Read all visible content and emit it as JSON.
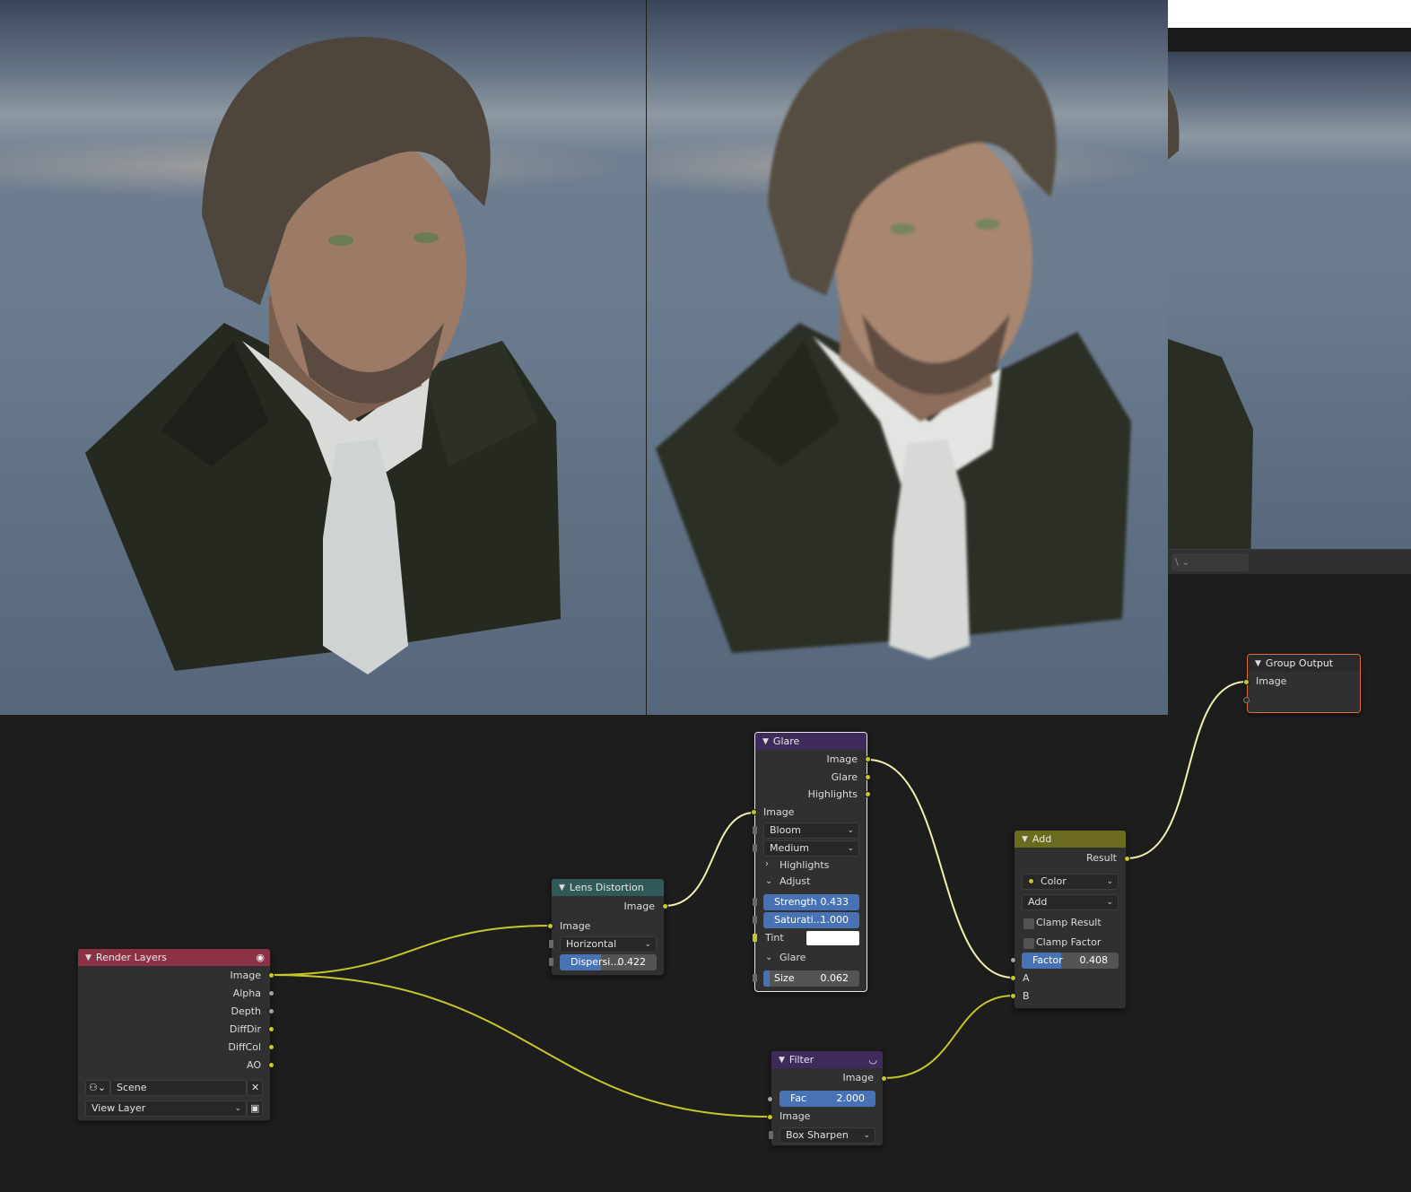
{
  "colors": {
    "render_layers_header": "#8c3246",
    "lens_distortion_header": "#305a5a",
    "glare_header": "#3f2a5c",
    "filter_header": "#3f2a5c",
    "add_header": "#6b6b1f",
    "group_output_header": "#2a2a2a",
    "socket_color": "#c7c729",
    "socket_float": "#a1a1a1",
    "slider_fill": "#4772b3"
  },
  "nodes": {
    "render_layers": {
      "title": "Render Layers",
      "outputs": [
        "Image",
        "Alpha",
        "Depth",
        "DiffDir",
        "DiffCol",
        "AO"
      ],
      "scene": "Scene",
      "view_layer": "View Layer",
      "header_icon": "eye-icon"
    },
    "lens_distortion": {
      "title": "Lens Distortion",
      "output": "Image",
      "input": "Image",
      "mode": "Horizontal",
      "dispersion_label": "Dispersi...",
      "dispersion_value": "0.422",
      "dispersion_fraction": 0.422
    },
    "glare": {
      "title": "Glare",
      "outputs": [
        "Image",
        "Glare",
        "Highlights"
      ],
      "input": "Image",
      "type": "Bloom",
      "quality": "Medium",
      "highlights_panel": "Highlights",
      "adjust_panel": "Adjust",
      "strength_label": "Strength",
      "strength_value": "0.433",
      "saturation_label": "Saturati...",
      "saturation_value": "1.000",
      "tint_label": "Tint",
      "glare_panel": "Glare",
      "size_label": "Size",
      "size_value": "0.062",
      "size_fraction": 0.062
    },
    "filter": {
      "title": "Filter",
      "output": "Image",
      "fac_label": "Fac",
      "fac_value": "2.000",
      "input": "Image",
      "type": "Box Sharpen"
    },
    "add": {
      "title": "Add",
      "output": "Result",
      "data_type": "Color",
      "blend": "Add",
      "clamp_result": "Clamp Result",
      "clamp_factor": "Clamp Factor",
      "factor_label": "Factor",
      "factor_value": "0.408",
      "factor_fraction": 0.408,
      "input_a": "A",
      "input_b": "B"
    },
    "group_output": {
      "title": "Group Output",
      "input": "Image"
    }
  }
}
